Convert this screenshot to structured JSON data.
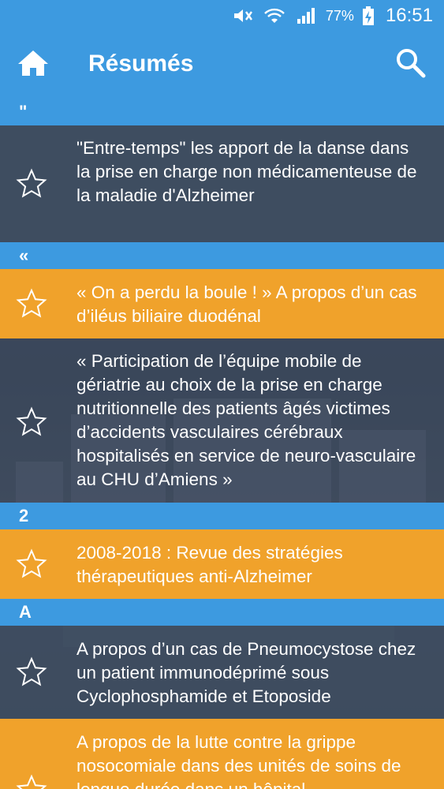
{
  "status_bar": {
    "battery_percent": "77%",
    "time": "16:51",
    "icons": [
      "mute-icon",
      "wifi-icon",
      "signal-icon",
      "battery-charging-icon"
    ]
  },
  "app_bar": {
    "title": "Résumés",
    "left_icon": "home-icon",
    "right_icon": "search-icon"
  },
  "colors": {
    "primary": "#3d9ae0",
    "accent_orange": "#f0a22b",
    "dark_row": "#3e4c60"
  },
  "list": [
    {
      "type": "header",
      "label": "\""
    },
    {
      "type": "item",
      "style": "dark",
      "text": "\"Entre-temps\" les apport de la danse dans la prise en charge non médicamenteuse de la maladie d'Alzheimer"
    },
    {
      "type": "header",
      "label": "«"
    },
    {
      "type": "item",
      "style": "orange",
      "text": "« On a perdu la boule ! » A propos d’un cas d’iléus biliaire duodénal"
    },
    {
      "type": "item",
      "style": "trans",
      "text": "« Participation de l’équipe mobile de gériatrie au choix de la prise en charge nutritionnelle  des patients âgés victimes d’accidents vasculaires cérébraux hospitalisés en service de neuro-vasculaire au CHU d’Amiens »"
    },
    {
      "type": "header",
      "label": "2"
    },
    {
      "type": "item",
      "style": "orange",
      "text": "2008-2018 : Revue des stratégies thérapeutiques anti-Alzheimer"
    },
    {
      "type": "header",
      "label": "A"
    },
    {
      "type": "item",
      "style": "dark",
      "text": "A propos d’un cas de Pneumocystose chez un patient immunodéprimé sous Cyclophosphamide et Etoposide"
    },
    {
      "type": "item",
      "style": "orange",
      "text": "A propos de la lutte contre la grippe nosocomiale dans des unités de soins de longue durée dans un hôpital"
    }
  ]
}
